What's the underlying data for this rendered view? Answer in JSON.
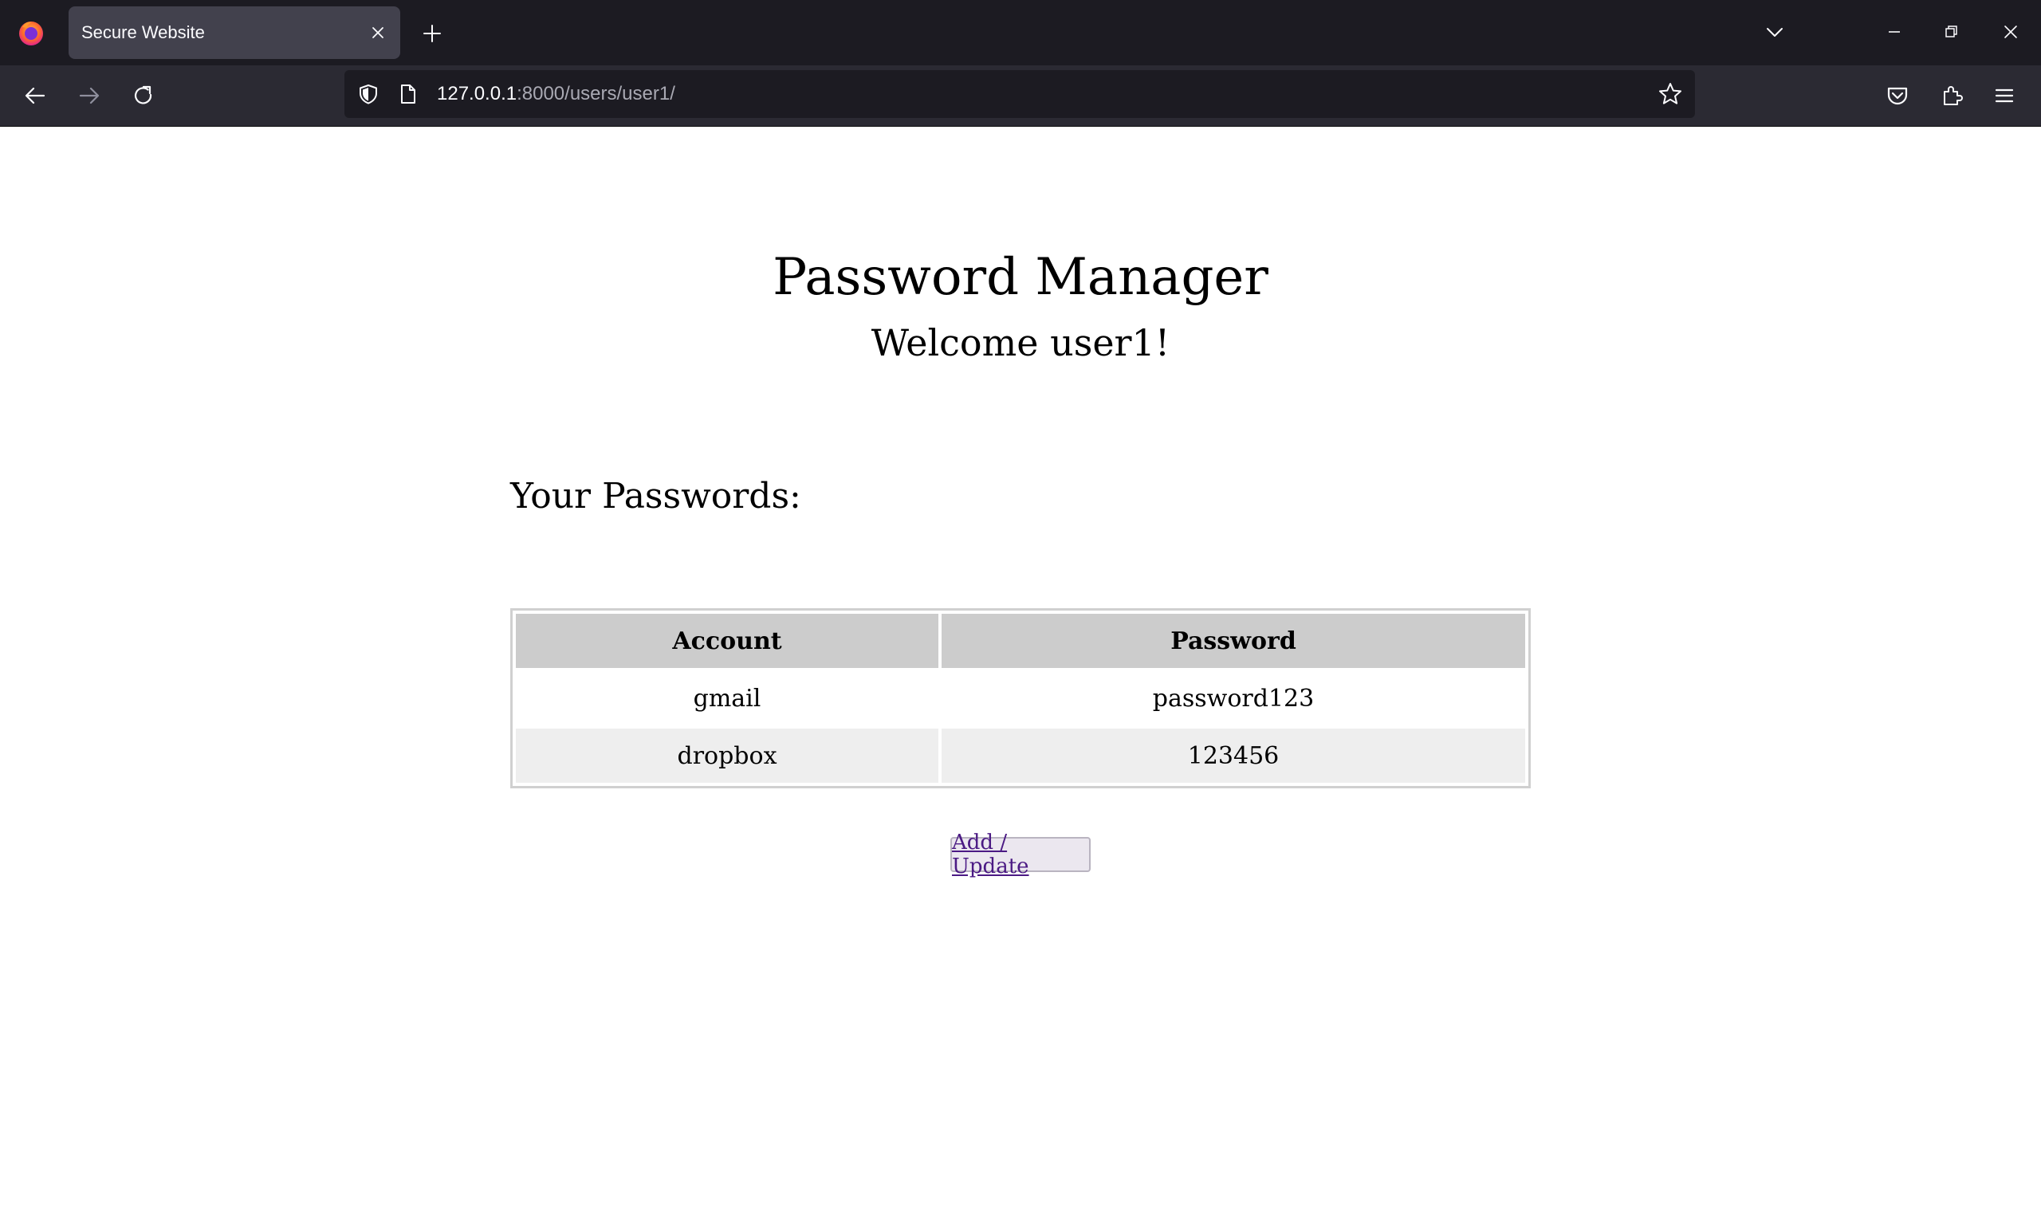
{
  "browser": {
    "tab": {
      "title": "Secure Website"
    },
    "url": {
      "host": "127.0.0.1",
      "path": ":8000/users/user1/"
    }
  },
  "page": {
    "title": "Password Manager",
    "welcome": "Welcome user1!",
    "section_heading": "Your Passwords:",
    "table": {
      "headers": [
        "Account",
        "Password"
      ],
      "rows": [
        {
          "account": "gmail",
          "password": "password123"
        },
        {
          "account": "dropbox",
          "password": "123456"
        }
      ]
    },
    "add_button_label": "Add / Update"
  },
  "colors": {
    "titlebar": "#1c1b22",
    "navbar": "#2b2a33",
    "active_tab": "#42414d",
    "table_header": "#cccccc",
    "table_alt_row": "#eeeeee",
    "link": "#4b1a84"
  },
  "icons": {
    "app": "firefox-icon",
    "tab_close": "close-icon",
    "new_tab": "plus-icon",
    "list_tabs": "chevron-down-icon",
    "back": "arrow-left-icon",
    "forward": "arrow-right-icon",
    "reload": "reload-icon",
    "tracking": "shield-icon",
    "page": "page-icon",
    "bookmark": "star-icon",
    "pocket": "pocket-icon",
    "extensions": "puzzle-icon",
    "menu": "hamburger-menu-icon"
  }
}
